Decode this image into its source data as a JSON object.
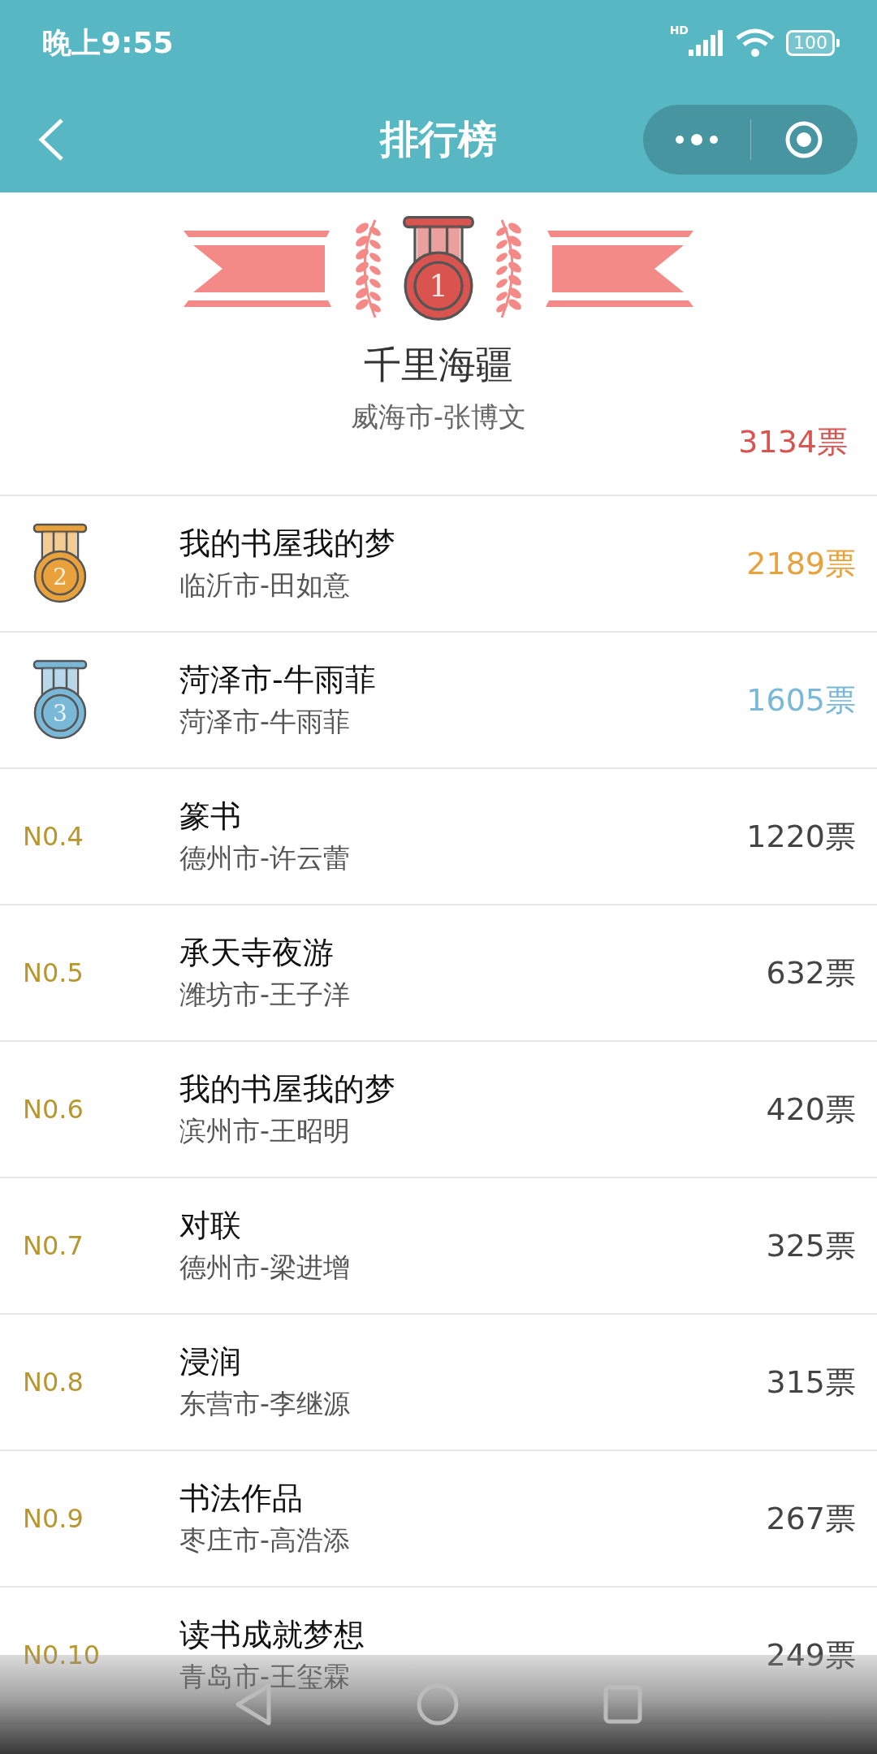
{
  "status_bar": {
    "time": "晚上9:55",
    "network": "HD",
    "battery": "100"
  },
  "nav": {
    "title": "排行榜"
  },
  "champion": {
    "medal_number": "1",
    "title": "千里海疆",
    "author": "威海市-张博文",
    "votes": "3134票",
    "color": "#d9534f"
  },
  "rows": [
    {
      "kind": "medal",
      "medal_number": "2",
      "title": "我的书屋我的梦",
      "author": "临沂市-田如意",
      "votes": "2189票",
      "color": "#e9a23b"
    },
    {
      "kind": "medal",
      "medal_number": "3",
      "title": "菏泽市-牛雨菲",
      "author": "菏泽市-牛雨菲",
      "votes": "1605票",
      "color": "#7ab8d8"
    },
    {
      "kind": "rank",
      "rank": "N0.4",
      "title": "篆书",
      "author": "德州市-许云蕾",
      "votes": "1220票",
      "color": "#444444"
    },
    {
      "kind": "rank",
      "rank": "N0.5",
      "title": "承天寺夜游",
      "author": "潍坊市-王子洋",
      "votes": "632票",
      "color": "#444444"
    },
    {
      "kind": "rank",
      "rank": "N0.6",
      "title": "我的书屋我的梦",
      "author": "滨州市-王昭明",
      "votes": "420票",
      "color": "#444444"
    },
    {
      "kind": "rank",
      "rank": "N0.7",
      "title": "对联",
      "author": "德州市-梁进增",
      "votes": "325票",
      "color": "#444444"
    },
    {
      "kind": "rank",
      "rank": "N0.8",
      "title": "浸润",
      "author": "东营市-李继源",
      "votes": "315票",
      "color": "#444444"
    },
    {
      "kind": "rank",
      "rank": "N0.9",
      "title": "书法作品",
      "author": "枣庄市-高浩添",
      "votes": "267票",
      "color": "#444444"
    },
    {
      "kind": "rank",
      "rank": "N0.10",
      "title": "读书成就梦想",
      "author": "青岛市-王玺霖",
      "votes": "249票",
      "color": "#444444"
    }
  ]
}
